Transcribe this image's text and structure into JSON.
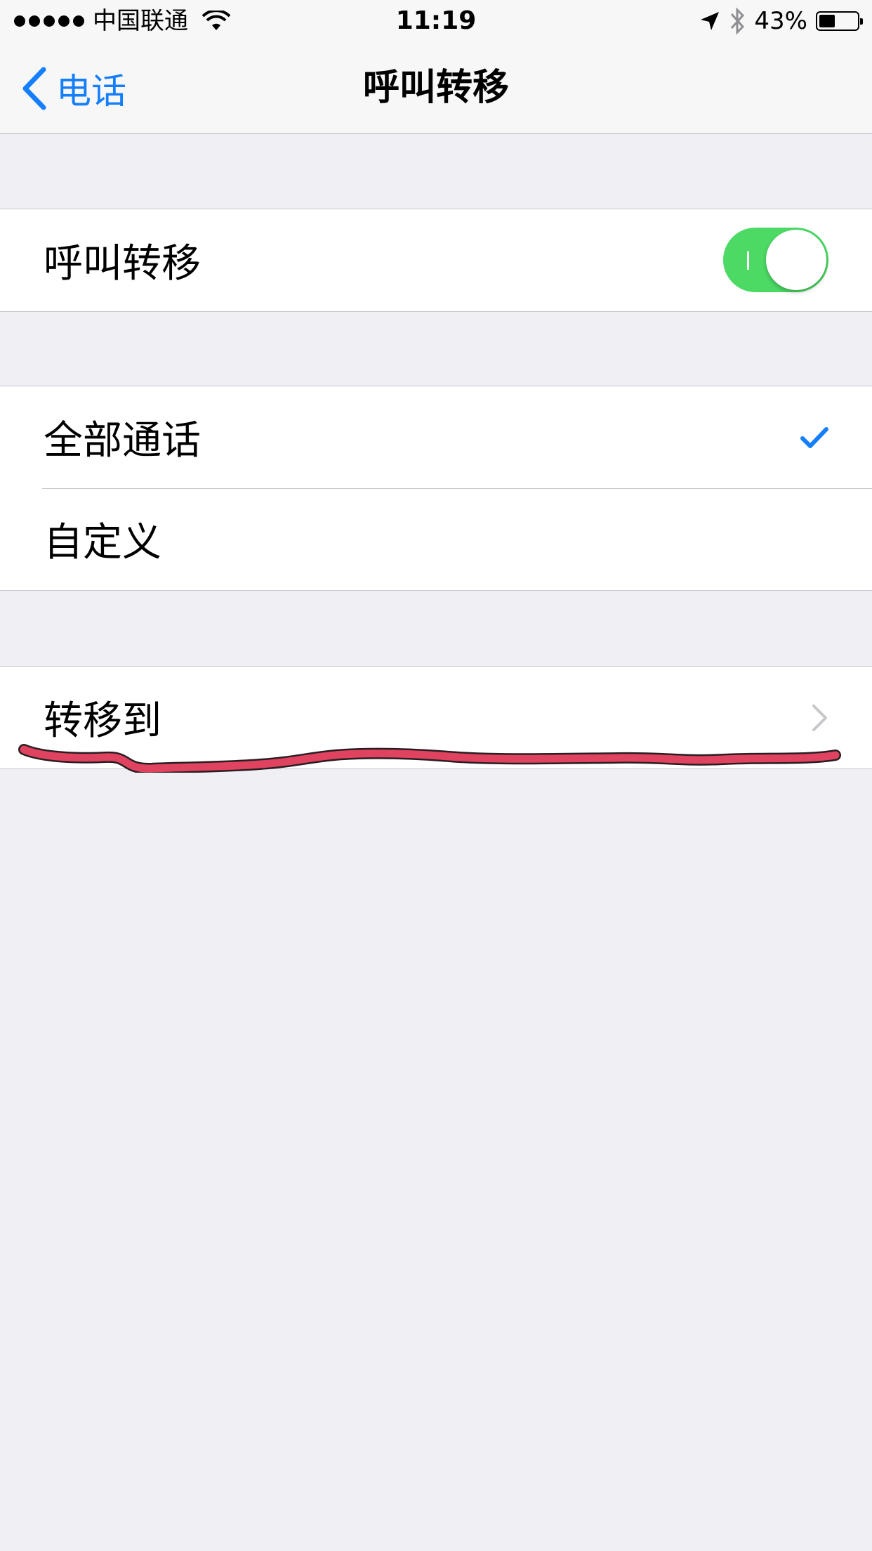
{
  "status_bar": {
    "carrier": "中国联通",
    "time": "11:19",
    "battery_percent": "43%",
    "battery_level": 0.43
  },
  "nav": {
    "back_label": "电话",
    "title": "呼叫转移"
  },
  "toggle_section": {
    "label": "呼叫转移",
    "enabled": true
  },
  "mode_section": {
    "items": [
      {
        "label": "全部通话",
        "checked": true
      },
      {
        "label": "自定义",
        "checked": false
      }
    ]
  },
  "forward_section": {
    "label": "转移到"
  },
  "colors": {
    "accent": "#157efb",
    "toggle_on": "#4cd964",
    "annotation": "#e0435f",
    "background": "#efeff4"
  }
}
